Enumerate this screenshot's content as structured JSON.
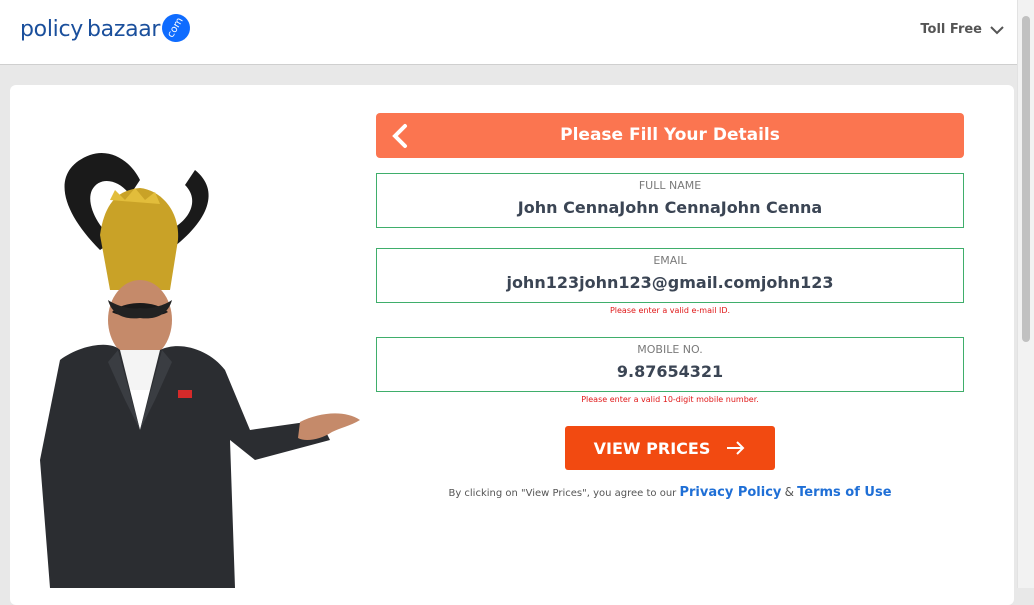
{
  "header": {
    "logo_policy": "policy",
    "logo_bazaar": "bazaar",
    "logo_com": "com",
    "toll_free": "Toll Free",
    "brand_color": "#1a4f9c"
  },
  "form": {
    "title": "Please Fill Your Details",
    "header_color": "#fb7550",
    "fields": {
      "full_name": {
        "label": "FULL NAME",
        "value": "John CennaJohn CennaJohn Cenna"
      },
      "email": {
        "label": "EMAIL",
        "value": "john123john123@gmail.comjohn123",
        "error": "Please enter a valid e-mail ID."
      },
      "mobile": {
        "label": "MOBILE NO.",
        "value": "9.87654321",
        "error": "Please enter a valid 10-digit mobile number."
      }
    },
    "cta_label": "VIEW PRICES",
    "cta_color": "#f24a11",
    "terms": {
      "prefix": "By clicking on \"View Prices\", you agree to our",
      "privacy": "Privacy Policy",
      "amp": "&",
      "tou": "Terms of Use"
    }
  },
  "icons": {
    "back": "chevron-left-icon",
    "dropdown": "chevron-down-icon",
    "arrow": "arrow-right-icon"
  }
}
